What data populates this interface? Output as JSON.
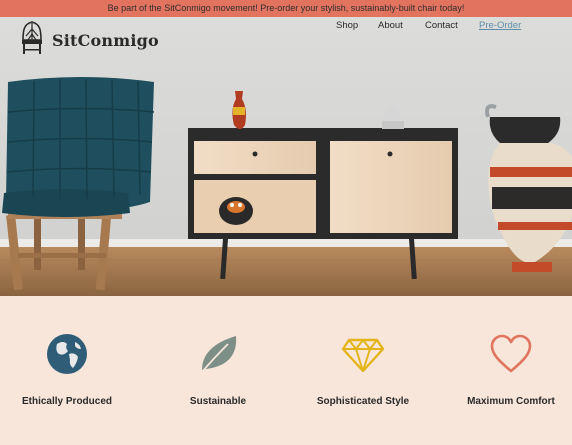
{
  "banner": {
    "text": "Be part of the SitConmigo movement!  Pre-order your stylish, sustainably-built chair today!"
  },
  "brand": {
    "name": "SitConmigo",
    "logo_icon": "chair-icon"
  },
  "nav": {
    "items": [
      {
        "label": "Shop"
      },
      {
        "label": "About"
      },
      {
        "label": "Contact"
      },
      {
        "label": "Pre-Order"
      }
    ]
  },
  "features": [
    {
      "label": "Ethically Produced",
      "icon": "globe-icon"
    },
    {
      "label": "Sustainable",
      "icon": "leaf-icon"
    },
    {
      "label": "Sophisticated Style",
      "icon": "diamond-icon"
    },
    {
      "label": "Maximum Comfort",
      "icon": "heart-icon"
    }
  ],
  "colors": {
    "banner_bg": "#e2735f",
    "features_bg": "#f8e6da",
    "globe": "#2f5d78",
    "leaf": "#7d8f86",
    "diamond": "#e3b51a",
    "heart": "#e07560",
    "link_active": "#5f8faa"
  }
}
